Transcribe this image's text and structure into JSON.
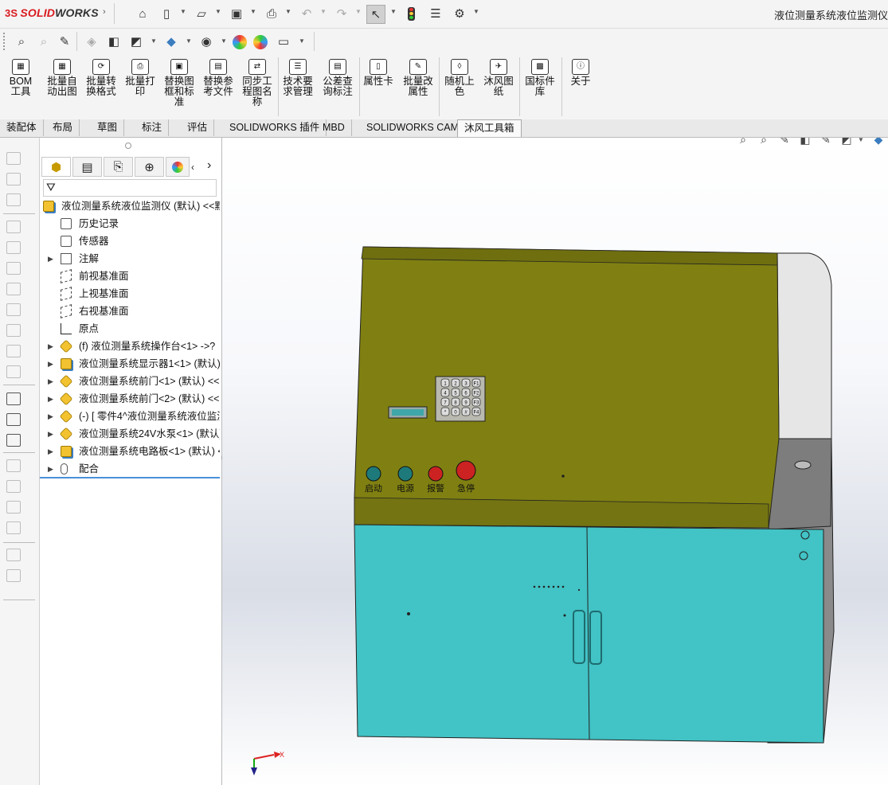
{
  "app": {
    "brand_ds": "3S",
    "brand_solid": "SOLID",
    "brand_works": "WORKS",
    "doc_title": "液位测量系统液位监测仪"
  },
  "commands": [
    {
      "label": "BOM工具",
      "icon": "bom-icon"
    },
    {
      "label": "批量自动出图",
      "icon": "batch-drawing-icon"
    },
    {
      "label": "批量转换格式",
      "icon": "batch-convert-icon"
    },
    {
      "label": "批量打印",
      "icon": "batch-print-icon"
    },
    {
      "label": "替换图框和标准",
      "icon": "replace-frame-icon"
    },
    {
      "label": "替换参考文件",
      "icon": "replace-reference-icon"
    },
    {
      "label": "同步工程图名称",
      "icon": "sync-name-icon"
    },
    {
      "label": "技术要求管理",
      "icon": "tech-requirements-icon"
    },
    {
      "label": "公差查询标注",
      "icon": "tolerance-icon"
    },
    {
      "label": "属性卡",
      "icon": "property-card-icon"
    },
    {
      "label": "批量改属性",
      "icon": "batch-property-icon"
    },
    {
      "label": "随机上色",
      "icon": "random-color-icon"
    },
    {
      "label": "沐风图纸",
      "icon": "mufeng-drawing-icon"
    },
    {
      "label": "国标件库",
      "icon": "gb-library-icon"
    },
    {
      "label": "关于",
      "icon": "about-icon"
    }
  ],
  "tabs": [
    {
      "label": "装配体",
      "active": false
    },
    {
      "label": "布局",
      "active": false
    },
    {
      "label": "草图",
      "active": false
    },
    {
      "label": "标注",
      "active": false
    },
    {
      "label": "评估",
      "active": false
    },
    {
      "label": "SOLIDWORKS 插件",
      "active": false
    },
    {
      "label": "MBD",
      "active": false
    },
    {
      "label": "SOLIDWORKS CAM",
      "active": false
    },
    {
      "label": "沐风工具箱",
      "active": true
    }
  ],
  "tree": {
    "root": "液位测量系统液位监测仪 (默认) <<默",
    "items": [
      {
        "label": "历史记录",
        "icon": "history-icon",
        "expand": false
      },
      {
        "label": "传感器",
        "icon": "sensor-icon",
        "expand": false
      },
      {
        "label": "注解",
        "icon": "annotation-icon",
        "expand": true
      },
      {
        "label": "前视基准面",
        "icon": "plane-icon",
        "expand": false
      },
      {
        "label": "上视基准面",
        "icon": "plane-icon",
        "expand": false
      },
      {
        "label": "右视基准面",
        "icon": "plane-icon",
        "expand": false
      },
      {
        "label": "原点",
        "icon": "origin-icon",
        "expand": false
      },
      {
        "label": "(f) 液位测量系统操作台<1> ->?",
        "icon": "part-icon",
        "expand": true
      },
      {
        "label": "液位测量系统显示器1<1> (默认)",
        "icon": "assembly-icon",
        "expand": true
      },
      {
        "label": "液位测量系统前门<1> (默认) <<",
        "icon": "part-icon",
        "expand": true
      },
      {
        "label": "液位测量系统前门<2> (默认) <<",
        "icon": "part-icon",
        "expand": true
      },
      {
        "label": "(-) [ 零件4^液位测量系统液位监测",
        "icon": "part-icon",
        "expand": true
      },
      {
        "label": "液位测量系统24V水泵<1> (默认)",
        "icon": "part-icon",
        "expand": true
      },
      {
        "label": "液位测量系统电路板<1> (默认) <",
        "icon": "assembly-icon",
        "expand": true
      },
      {
        "label": "配合",
        "icon": "mates-icon",
        "expand": true
      }
    ]
  },
  "model": {
    "buttons": [
      "启动",
      "电源",
      "报警",
      "急停"
    ],
    "keypad_keys": [
      "1",
      "2",
      "3",
      "F1",
      "4",
      "5",
      "6",
      "F2",
      "7",
      "8",
      "9",
      "F3",
      "*",
      "0",
      "#",
      "F4"
    ],
    "upper_color": "#808012",
    "lower_color": "#42c3c5",
    "side_color": "#e6e6e6"
  },
  "triad": {
    "x": "X"
  }
}
